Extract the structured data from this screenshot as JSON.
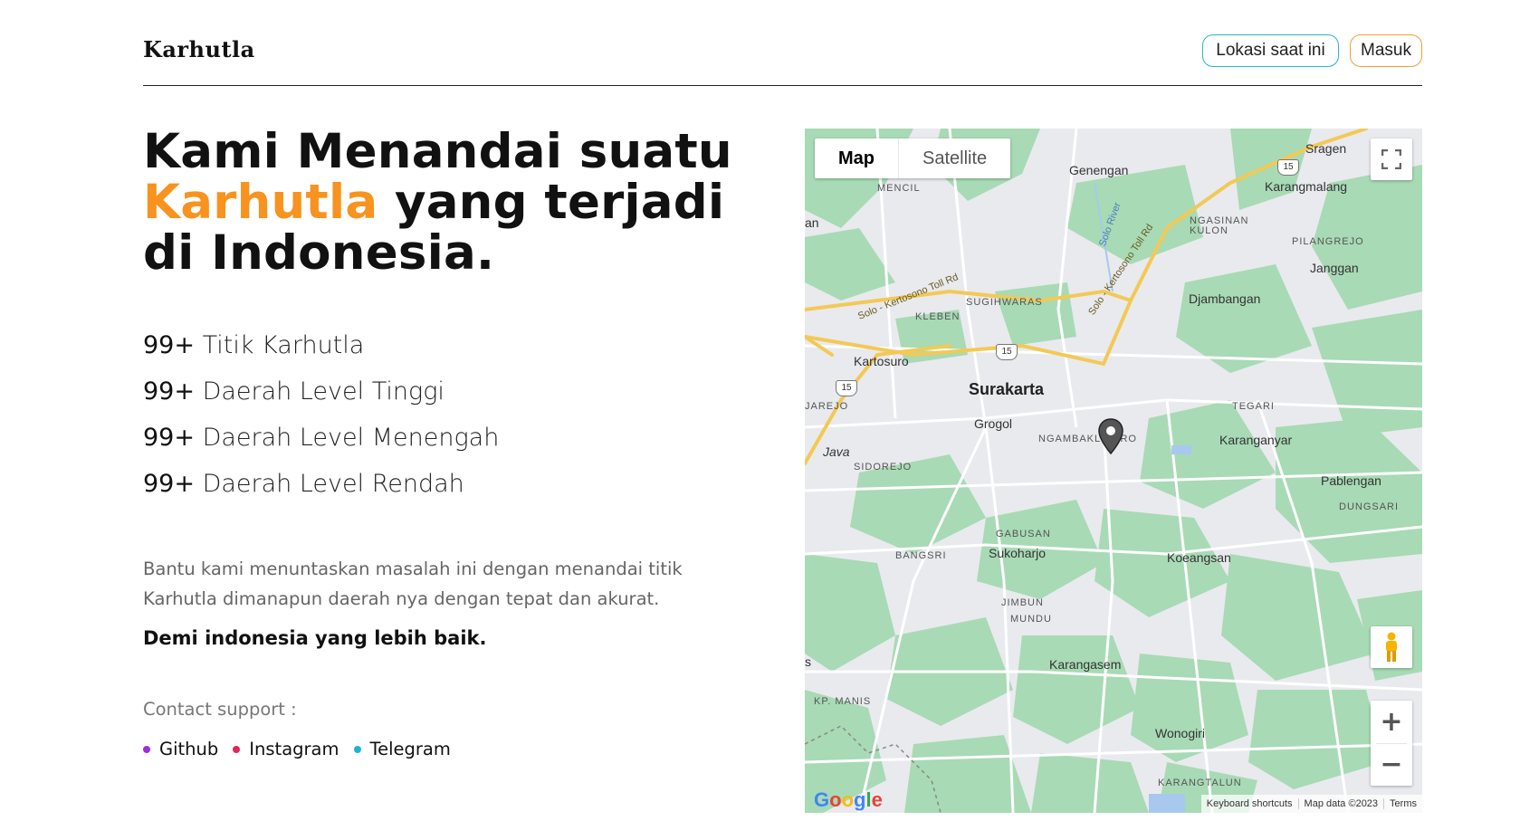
{
  "header": {
    "logo": "Karhutla",
    "location_button": "Lokasi saat ini",
    "login_button": "Masuk"
  },
  "hero": {
    "title_part1": "Kami Menandai suatu",
    "title_accent": "Karhutla",
    "title_part2": "yang terjadi di Indonesia."
  },
  "stats": [
    {
      "count": "99+",
      "label": "Titik Karhutla"
    },
    {
      "count": "99+",
      "label": "Daerah Level Tinggi"
    },
    {
      "count": "99+",
      "label": "Daerah Level Menengah"
    },
    {
      "count": "99+",
      "label": "Daerah Level Rendah"
    }
  ],
  "description": "Bantu kami menuntaskan masalah ini dengan menandai titik Karhutla dimanapun daerah nya dengan tepat dan akurat.",
  "tagline": "Demi indonesia yang lebih baik.",
  "contact": {
    "label": "Contact support :",
    "links": [
      {
        "label": "Github",
        "color": "#9b30d9"
      },
      {
        "label": "Instagram",
        "color": "#e0245e"
      },
      {
        "label": "Telegram",
        "color": "#1cb5d6"
      }
    ]
  },
  "colors": {
    "accent": "#f7931e",
    "location_border": "#26b5c6",
    "login_border": "#f0a030",
    "map_green": "#a8dab5",
    "map_road": "#fdd865"
  },
  "map": {
    "type_map": "Map",
    "type_satellite": "Satellite",
    "zoom_in": "+",
    "zoom_out": "−",
    "google": "Google",
    "keyboard_shortcuts": "Keyboard shortcuts",
    "map_data": "Map data ©2023",
    "terms": "Terms",
    "labels": {
      "sragen": "Sragen",
      "genengan": "Genengan",
      "karangmalang": "Karangmalang",
      "mencil": "MENCIL",
      "ngasinan_kulon": "NGASINAN KULON",
      "pilangrejo": "PILANGREJO",
      "janggan": "Janggan",
      "djambangan": "Djambangan",
      "sugihwaras": "SUGIHWARAS",
      "kleben": "KLEBEN",
      "kartosuro": "Kartosuro",
      "surakarta": "Surakarta",
      "jarejo": "JAREJO",
      "tegari": "TEGARI",
      "grogol": "Grogol",
      "ngambaklipuro": "NGAMBAKLIPURO",
      "karanganyar": "Karanganyar",
      "java": "Java",
      "sidorejo": "SIDOREJO",
      "pablengan": "Pablengan",
      "dungsari": "DUNGSARI",
      "gabusan": "GABUSAN",
      "bangsri": "BANGSRI",
      "sukoharjo": "Sukoharjo",
      "koeangsan": "Koeangsan",
      "jimbun": "JIMBUN",
      "mundu": "MUNDU",
      "karangasem": "Karangasem",
      "kp_manis": "KP. MANIS",
      "wonogiri": "Wonogiri",
      "karangtalun": "KARANGTALUN",
      "road_solo_kertosono_1": "Solo - Kertosono Toll Rd",
      "road_solo_kertosono_2": "Solo - Kertosono Toll Rd",
      "river_solo": "Solo River",
      "hwy_15": "15",
      "edge_an": "an",
      "edge_s": "s"
    }
  }
}
